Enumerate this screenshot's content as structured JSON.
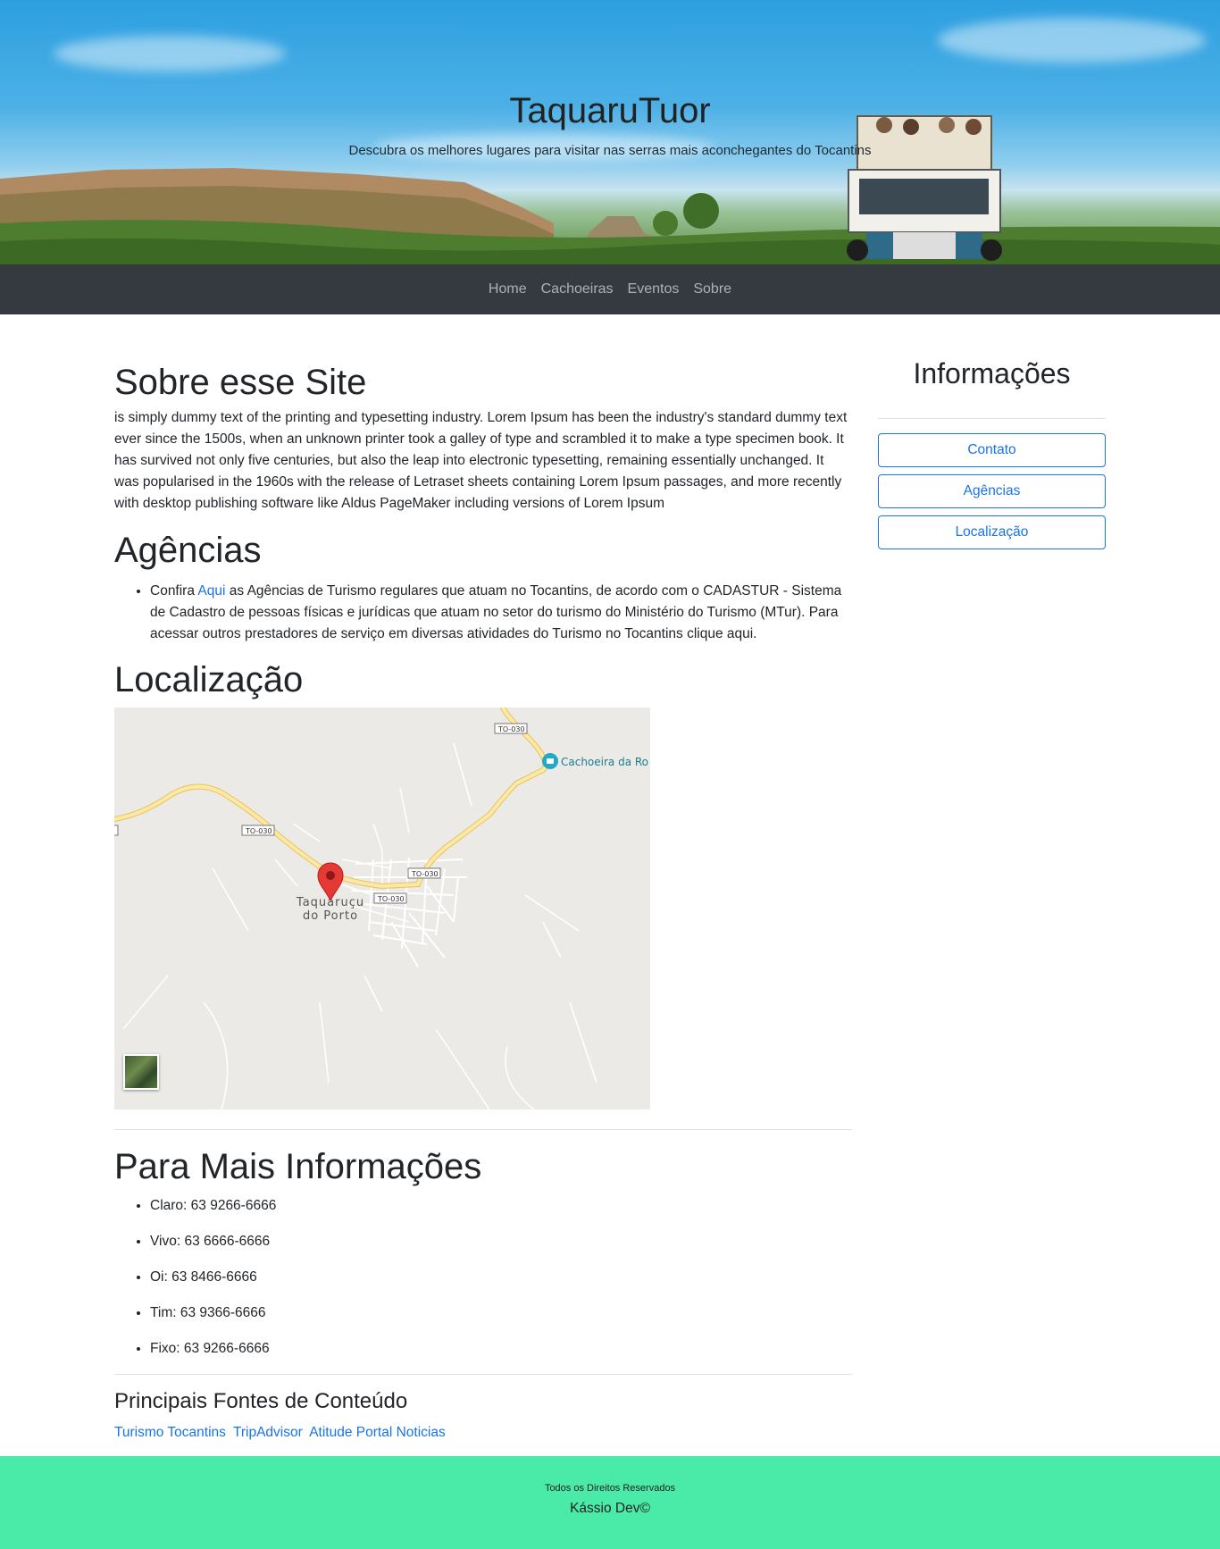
{
  "hero": {
    "title": "TaquaruTuor",
    "subtitle": "Descubra os melhores lugares para visitar nas serras mais aconchegantes do Tocantins"
  },
  "nav": [
    "Home",
    "Cachoeiras",
    "Eventos",
    "Sobre"
  ],
  "about": {
    "heading": "Sobre esse Site",
    "text": "is simply dummy text of the printing and typesetting industry. Lorem Ipsum has been the industry's standard dummy text ever since the 1500s, when an unknown printer took a galley of type and scrambled it to make a type specimen book. It has survived not only five centuries, but also the leap into electronic typesetting, remaining essentially unchanged. It was popularised in the 1960s with the release of Letraset sheets containing Lorem Ipsum passages, and more recently with desktop publishing software like Aldus PageMaker including versions of Lorem Ipsum"
  },
  "agencias": {
    "heading": "Agências",
    "prefix": "Confira ",
    "link": "Aqui",
    "suffix": " as Agências de Turismo regulares que atuam no Tocantins, de acordo com o CADASTUR - Sistema de Cadastro de pessoas físicas e jurídicas que atuam no setor do turismo do Ministério do Turismo (MTur). Para acessar outros prestadores de serviço em diversas atividades do Turismo no Tocantins clique aqui."
  },
  "localizacao": {
    "heading": "Localização",
    "map": {
      "place_name_line1": "Taquaruçu",
      "place_name_line2": "do Porto",
      "poi_label": "Cachoeira da Ro",
      "road_label": "TO-030"
    }
  },
  "more_info": {
    "heading": "Para Mais Informações",
    "phones": [
      "Claro: 63 9266-6666",
      "Vivo: 63 6666-6666",
      "Oi: 63 8466-6666",
      "Tim: 63 9366-6666",
      "Fixo: 63 9266-6666"
    ]
  },
  "fontes": {
    "heading": "Principais Fontes de Conteúdo",
    "links": [
      "Turismo Tocantins",
      "TripAdvisor",
      "Atitude Portal Noticias"
    ]
  },
  "sidebar": {
    "heading": "Informações",
    "buttons": [
      "Contato",
      "Agências",
      "Localização"
    ]
  },
  "footer": {
    "rights": "Todos os Direitos Reservados",
    "author": "Kássio Dev©"
  },
  "colors": {
    "nav_bg": "#343a40",
    "link": "#1a73e8",
    "footer_bg": "#4aeaa8",
    "road": "#f7d774",
    "pin": "#e53935"
  }
}
